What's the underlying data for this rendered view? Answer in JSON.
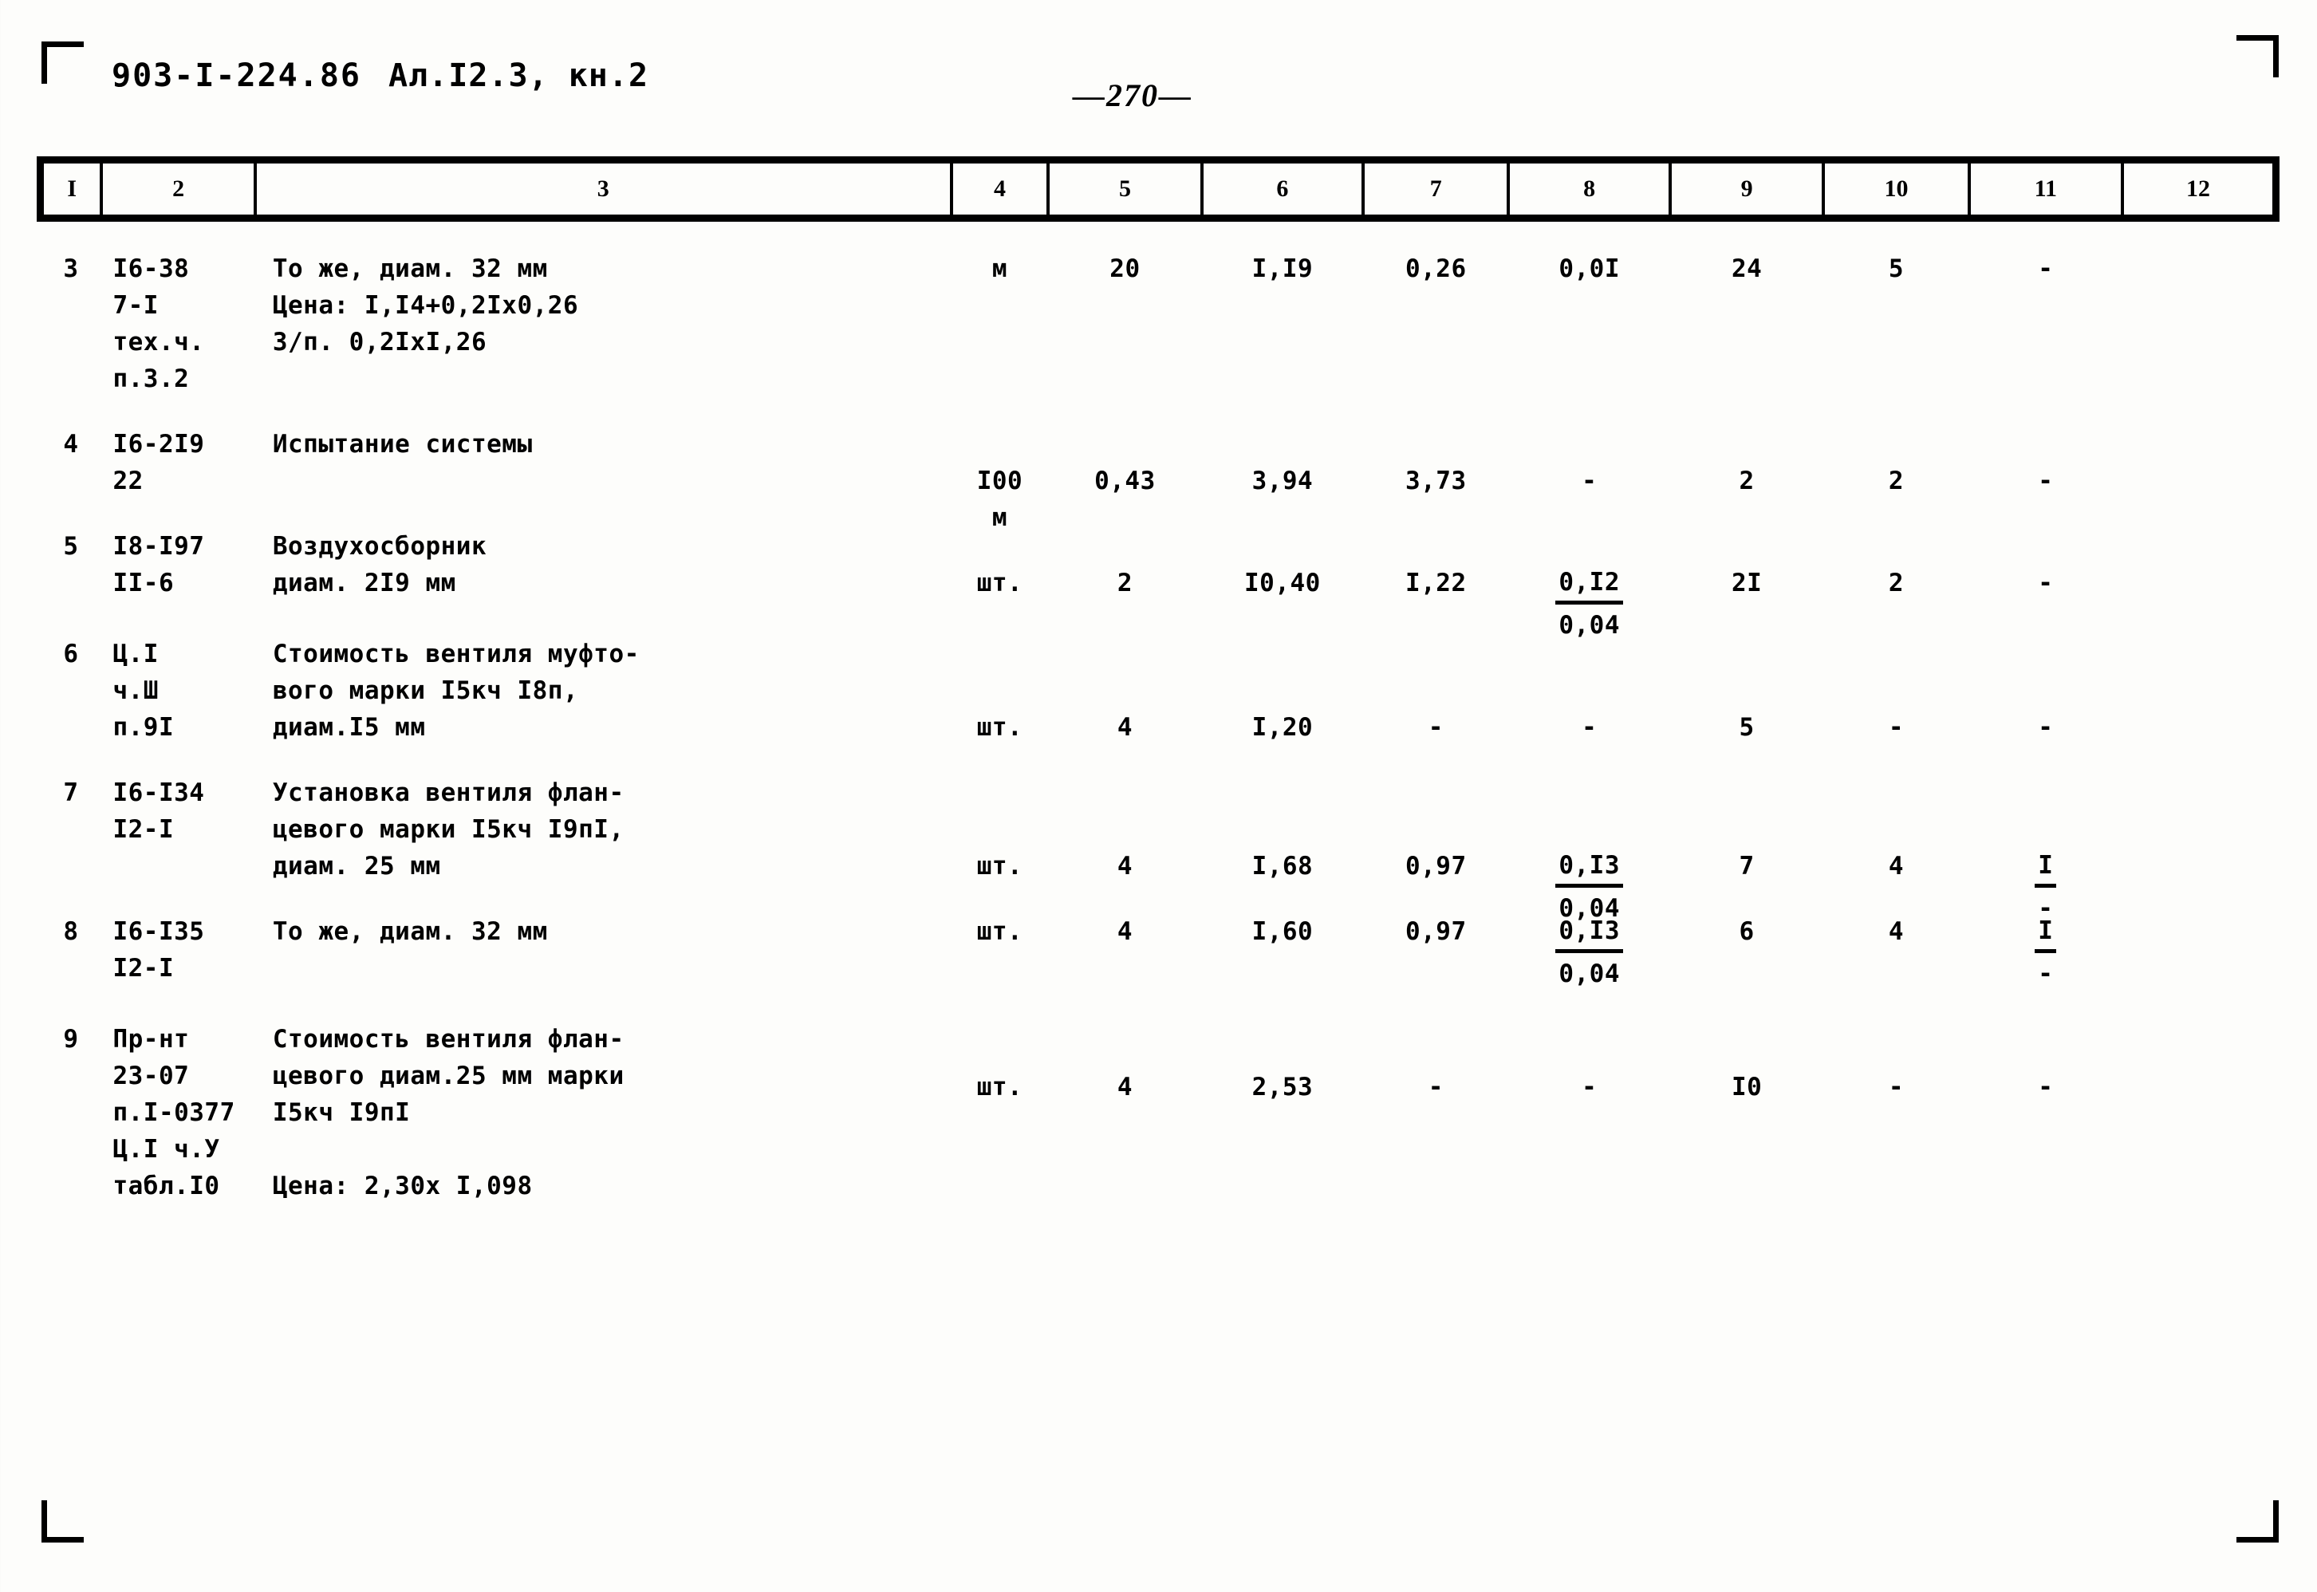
{
  "document": {
    "series_code": "903-I-224.86",
    "album": "Ал.I2.3, кн.2",
    "page_number": "—270—"
  },
  "table": {
    "column_headers": [
      "I",
      "2",
      "3",
      "4",
      "5",
      "6",
      "7",
      "8",
      "9",
      "10",
      "11",
      "12"
    ],
    "rows": [
      {
        "no": "3",
        "code_lines": [
          "I6-38",
          "7-I",
          "тех.ч.",
          "п.3.2"
        ],
        "desc_lines": [
          "То же, диам. 32 мм",
          "Цена: I,I4+0,2Iх0,26",
          "З/п. 0,2IхI,26"
        ],
        "unit_lines": [
          "м"
        ],
        "c5": "20",
        "c6": "I,I9",
        "c7": "0,26",
        "c8": "0,0I",
        "c8_bottom": "",
        "c9": "24",
        "c10": "5",
        "c11": "-",
        "c11_bottom": "",
        "c12": ""
      },
      {
        "no": "4",
        "code_lines": [
          "I6-2I9",
          "22"
        ],
        "desc_lines": [
          "Испытание системы"
        ],
        "unit_lines": [
          "I00",
          "м"
        ],
        "c5": "0,43",
        "c6": "3,94",
        "c7": "3,73",
        "c8": "-",
        "c8_bottom": "",
        "c9": "2",
        "c10": "2",
        "c11": "-",
        "c11_bottom": "",
        "c12": ""
      },
      {
        "no": "5",
        "code_lines": [
          "I8-I97",
          "II-6"
        ],
        "desc_lines": [
          "Воздухосборник",
          "диам. 2I9 мм"
        ],
        "unit_lines": [
          "шт."
        ],
        "c5": "2",
        "c6": "I0,40",
        "c7": "I,22",
        "c8": "0,I2",
        "c8_bottom": "0,04",
        "c9": "2I",
        "c10": "2",
        "c11": "-",
        "c11_bottom": "",
        "c12": ""
      },
      {
        "no": "6",
        "code_lines": [
          "Ц.I",
          "ч.Ш",
          "п.9I"
        ],
        "desc_lines": [
          "Стоимость вентиля муфто-",
          "вого марки I5кч I8п,",
          "диам.I5 мм"
        ],
        "unit_lines": [
          "шт."
        ],
        "c5": "4",
        "c6": "I,20",
        "c7": "-",
        "c8": "-",
        "c8_bottom": "",
        "c9": "5",
        "c10": "-",
        "c11": "-",
        "c11_bottom": "",
        "c12": ""
      },
      {
        "no": "7",
        "code_lines": [
          "I6-I34",
          "I2-I"
        ],
        "desc_lines": [
          "Установка вентиля флан-",
          "цевого марки I5кч I9пI,",
          "диам. 25 мм"
        ],
        "unit_lines": [
          "шт."
        ],
        "c5": "4",
        "c6": "I,68",
        "c7": "0,97",
        "c8": "0,I3",
        "c8_bottom": "0,04",
        "c9": "7",
        "c10": "4",
        "c11": "I",
        "c11_bottom": "-",
        "c12": ""
      },
      {
        "no": "8",
        "code_lines": [
          "I6-I35",
          "I2-I"
        ],
        "desc_lines": [
          "То же, диам. 32 мм"
        ],
        "unit_lines": [
          "шт."
        ],
        "c5": "4",
        "c6": "I,60",
        "c7": "0,97",
        "c8": "0,I3",
        "c8_bottom": "0,04",
        "c9": "6",
        "c10": "4",
        "c11": "I",
        "c11_bottom": "-",
        "c12": ""
      },
      {
        "no": "9",
        "code_lines": [
          "Пр-нт",
          "23-07",
          "п.I-0377",
          "Ц.I ч.У",
          "табл.I0"
        ],
        "desc_lines": [
          "Стоимость вентиля флан-",
          "цевого диам.25 мм марки",
          "I5кч I9пI",
          "",
          "Цена: 2,30х I,098"
        ],
        "unit_lines": [
          "шт."
        ],
        "c5": "4",
        "c6": "2,53",
        "c7": "-",
        "c8": "-",
        "c8_bottom": "",
        "c9": "I0",
        "c10": "-",
        "c11": "-",
        "c11_bottom": "",
        "c12": ""
      }
    ]
  }
}
